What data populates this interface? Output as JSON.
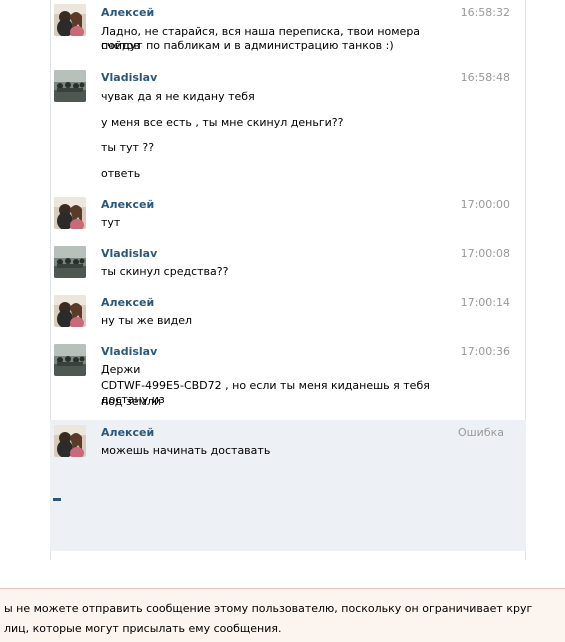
{
  "messages": [
    {
      "author": "Алексей",
      "time": "16:58:32",
      "lines": [
        "Ладно, не старайся, вся наша переписка, твои номера счетов",
        "пойдут по пабликам и в администрацию танков :)"
      ]
    },
    {
      "author": "Vladislav",
      "time": "16:58:48",
      "lines": [
        "чувак да я не кидану тебя",
        "у меня все есть , ты мне скинул деньги??",
        "ты тут ??",
        "ответь"
      ]
    },
    {
      "author": "Алексей",
      "time": "17:00:00",
      "lines": [
        "тут"
      ]
    },
    {
      "author": "Vladislav",
      "time": "17:00:08",
      "lines": [
        "ты скинул средства??"
      ]
    },
    {
      "author": "Алексей",
      "time": "17:00:14",
      "lines": [
        "ну ты же видел"
      ]
    },
    {
      "author": "Vladislav",
      "time": "17:00:36",
      "lines": [
        "Держи",
        "CDTWF-499E5-CBD72 , но если ты меня киданешь я тебя достану из",
        "под земли"
      ]
    },
    {
      "author": "Алексей",
      "time": "Ошибка",
      "lines": [
        "можешь начинать доставать"
      ]
    }
  ],
  "composer_marker": "-",
  "notice": "ы не можете отправить сообщение этому пользователю, поскольку он ограничивает круг лиц, которые могут присылать ему сообщения.",
  "colors": {
    "author": "#2b587a",
    "time": "#999999",
    "error_bg": "#edf0f5",
    "notice_bg": "#fcf4ee",
    "notice_border": "#e9c2b1"
  }
}
